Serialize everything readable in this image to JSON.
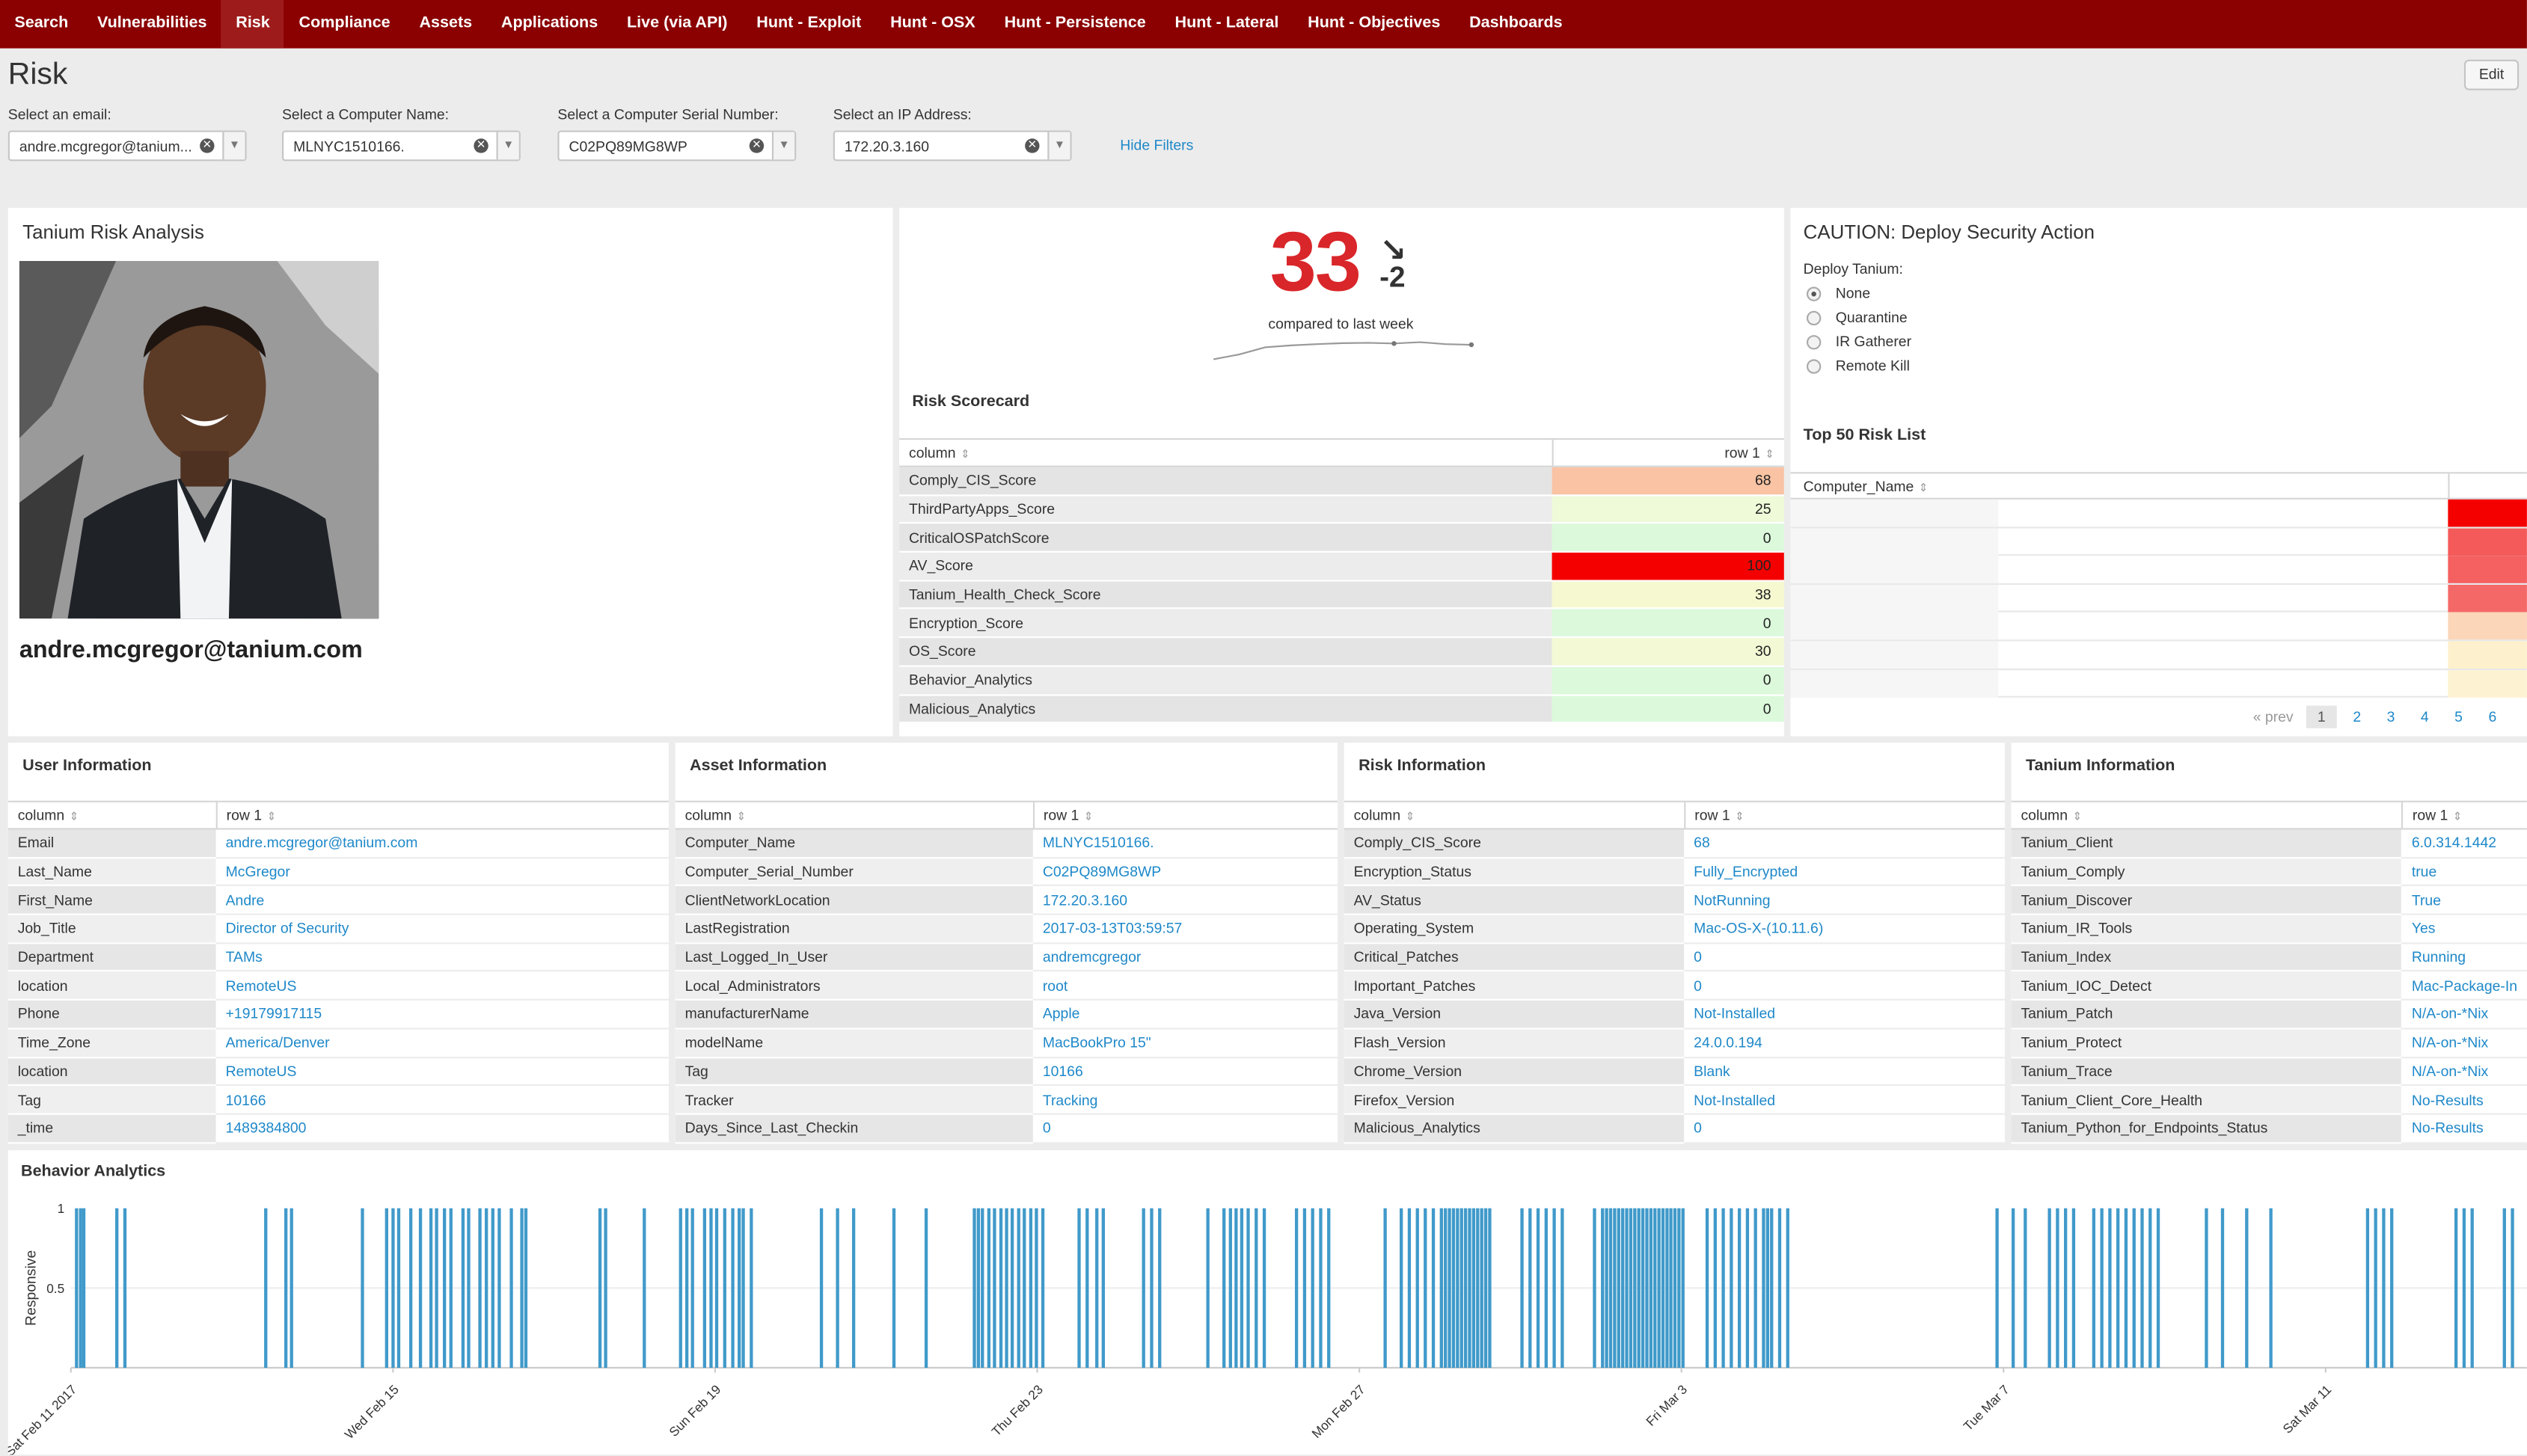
{
  "nav": [
    "Search",
    "Vulnerabilities",
    "Risk",
    "Compliance",
    "Assets",
    "Applications",
    "Live (via API)",
    "Hunt - Exploit",
    "Hunt - OSX",
    "Hunt - Persistence",
    "Hunt - Lateral",
    "Hunt - Objectives",
    "Dashboards"
  ],
  "page": {
    "title": "Risk",
    "edit_label": "Edit",
    "hide_filters": "Hide Filters"
  },
  "filters": [
    {
      "label": "Select an email:",
      "value": "andre.mcgregor@tanium..."
    },
    {
      "label": "Select a Computer Name:",
      "value": "MLNYC1510166."
    },
    {
      "label": "Select a Computer Serial Number:",
      "value": "C02PQ89MG8WP"
    },
    {
      "label": "Select an IP Address:",
      "value": "172.20.3.160"
    }
  ],
  "risk_analysis": {
    "title": "Tanium Risk Analysis",
    "email": "andre.mcgregor@tanium.com"
  },
  "score": {
    "value": "33",
    "delta": "-2",
    "caption": "compared to last week",
    "trend": [
      0.15,
      0.3,
      0.52,
      0.58,
      0.62,
      0.65,
      0.66,
      0.64,
      0.68,
      0.62,
      0.6
    ],
    "accent": "#d9262a"
  },
  "scorecard": {
    "title": "Risk Scorecard",
    "col1": "column",
    "col2": "row 1",
    "rows": [
      {
        "k": "Comply_CIS_Score",
        "v": "68",
        "color": "#f9c3a4"
      },
      {
        "k": "ThirdPartyApps_Score",
        "v": "25",
        "color": "#eefad8"
      },
      {
        "k": "CriticalOSPatchScore",
        "v": "0",
        "color": "#dcf9dc"
      },
      {
        "k": "AV_Score",
        "v": "100",
        "color": "#f50000"
      },
      {
        "k": "Tanium_Health_Check_Score",
        "v": "38",
        "color": "#f6f8d0"
      },
      {
        "k": "Encryption_Score",
        "v": "0",
        "color": "#dcf9dc"
      },
      {
        "k": "OS_Score",
        "v": "30",
        "color": "#f2f9d4"
      },
      {
        "k": "Behavior_Analytics",
        "v": "0",
        "color": "#dcf9dc"
      },
      {
        "k": "Malicious_Analytics",
        "v": "0",
        "color": "#dcf9dc"
      }
    ]
  },
  "caution": {
    "title": "CAUTION: Deploy Security Action",
    "deploy_label": "Deploy Tanium:",
    "options": [
      "None",
      "Quarantine",
      "IR Gatherer",
      "Remote Kill"
    ],
    "selected": 0
  },
  "top50": {
    "title": "Top 50 Risk List",
    "col": "Computer_Name",
    "bars": [
      "#f50000",
      "#f55a5a",
      "#f56060",
      "#f56868",
      "#fbd6b8",
      "#fdf0cc",
      "#fdf3d2"
    ],
    "pager": {
      "prev": "« prev",
      "pages": [
        "1",
        "2",
        "3",
        "4",
        "5",
        "6"
      ]
    }
  },
  "info_panels": [
    {
      "title": "User Information",
      "col1": "column",
      "col2": "row 1",
      "rows": [
        [
          "Email",
          "andre.mcgregor@tanium.com"
        ],
        [
          "Last_Name",
          "McGregor"
        ],
        [
          "First_Name",
          "Andre"
        ],
        [
          "Job_Title",
          "Director of Security"
        ],
        [
          "Department",
          "TAMs"
        ],
        [
          "location",
          "RemoteUS"
        ],
        [
          "Phone",
          "+19179917115"
        ],
        [
          "Time_Zone",
          "America/Denver"
        ],
        [
          "location",
          "RemoteUS"
        ],
        [
          "Tag",
          "10166"
        ],
        [
          "_time",
          "1489384800"
        ]
      ]
    },
    {
      "title": "Asset Information",
      "col1": "column",
      "col2": "row 1",
      "rows": [
        [
          "Computer_Name",
          "MLNYC1510166."
        ],
        [
          "Computer_Serial_Number",
          "C02PQ89MG8WP"
        ],
        [
          "ClientNetworkLocation",
          "172.20.3.160"
        ],
        [
          "LastRegistration",
          "2017-03-13T03:59:57"
        ],
        [
          "Last_Logged_In_User",
          "andremcgregor"
        ],
        [
          "Local_Administrators",
          "root"
        ],
        [
          "manufacturerName",
          "Apple"
        ],
        [
          "modelName",
          "MacBookPro 15\""
        ],
        [
          "Tag",
          "10166"
        ],
        [
          "Tracker",
          "Tracking"
        ],
        [
          "Days_Since_Last_Checkin",
          "0"
        ]
      ]
    },
    {
      "title": "Risk Information",
      "col1": "column",
      "col2": "row 1",
      "rows": [
        [
          "Comply_CIS_Score",
          "68"
        ],
        [
          "Encryption_Status",
          "Fully_Encrypted"
        ],
        [
          "AV_Status",
          "NotRunning"
        ],
        [
          "Operating_System",
          "Mac-OS-X-(10.11.6)"
        ],
        [
          "Critical_Patches",
          "0"
        ],
        [
          "Important_Patches",
          "0"
        ],
        [
          "Java_Version",
          "Not-Installed"
        ],
        [
          "Flash_Version",
          "24.0.0.194"
        ],
        [
          "Chrome_Version",
          "Blank"
        ],
        [
          "Firefox_Version",
          "Not-Installed"
        ],
        [
          "Malicious_Analytics",
          "0"
        ]
      ]
    },
    {
      "title": "Tanium Information",
      "col1": "column",
      "col2": "row 1",
      "rows": [
        [
          "Tanium_Client",
          "6.0.314.1442"
        ],
        [
          "Tanium_Comply",
          "true"
        ],
        [
          "Tanium_Discover",
          "True"
        ],
        [
          "Tanium_IR_Tools",
          "Yes"
        ],
        [
          "Tanium_Index",
          "Running"
        ],
        [
          "Tanium_IOC_Detect",
          "Mac-Package-In"
        ],
        [
          "Tanium_Patch",
          "N/A-on-*Nix"
        ],
        [
          "Tanium_Protect",
          "N/A-on-*Nix"
        ],
        [
          "Tanium_Trace",
          "N/A-on-*Nix"
        ],
        [
          "Tanium_Client_Core_Health",
          "No-Results"
        ],
        [
          "Tanium_Python_for_Endpoints_Status",
          "No-Results"
        ]
      ]
    }
  ],
  "chart_data": {
    "type": "bar",
    "title": "Behavior Analytics",
    "ylabel": "Responsive",
    "ylim": [
      0,
      1
    ],
    "yticks": [
      "1",
      "0.5"
    ],
    "xticks": [
      "Sat Feb 11 2017",
      "Wed Feb 15",
      "Sun Feb 19",
      "Thu Feb 23",
      "Mon Feb 27",
      "Fri Mar 3",
      "Tue Mar 7",
      "Sat Mar 11"
    ],
    "x_range_days": [
      0,
      30.5
    ],
    "series_color": "#2b8fc4",
    "event_days": [
      0.05,
      0.1,
      0.14,
      0.55,
      0.65,
      2.4,
      2.65,
      2.72,
      3.6,
      3.9,
      3.98,
      4.05,
      4.2,
      4.32,
      4.45,
      4.52,
      4.62,
      4.7,
      4.85,
      4.92,
      5.06,
      5.14,
      5.22,
      5.3,
      5.45,
      5.58,
      5.63,
      6.55,
      6.62,
      7.1,
      7.55,
      7.63,
      7.7,
      7.85,
      7.93,
      8.0,
      8.1,
      8.2,
      8.28,
      8.33,
      8.43,
      9.3,
      9.5,
      9.7,
      10.2,
      10.6,
      11.2,
      11.25,
      11.3,
      11.38,
      11.45,
      11.53,
      11.6,
      11.67,
      11.75,
      11.82,
      11.9,
      11.97,
      12.05,
      12.5,
      12.6,
      12.72,
      12.8,
      13.3,
      13.4,
      13.5,
      14.1,
      14.3,
      14.38,
      14.45,
      14.52,
      14.6,
      14.7,
      14.8,
      15.2,
      15.3,
      15.4,
      15.5,
      15.6,
      16.3,
      16.5,
      16.6,
      16.7,
      16.8,
      16.9,
      17.0,
      17.05,
      17.1,
      17.15,
      17.2,
      17.25,
      17.3,
      17.35,
      17.4,
      17.45,
      17.5,
      17.55,
      17.6,
      18.0,
      18.1,
      18.2,
      18.3,
      18.4,
      18.5,
      18.9,
      19.0,
      19.05,
      19.1,
      19.15,
      19.2,
      19.25,
      19.3,
      19.35,
      19.4,
      19.45,
      19.5,
      19.55,
      19.6,
      19.65,
      19.7,
      19.75,
      19.8,
      19.85,
      19.9,
      19.95,
      20.0,
      20.3,
      20.4,
      20.5,
      20.6,
      20.7,
      20.8,
      20.9,
      21.0,
      21.05,
      21.1,
      21.2,
      21.3,
      23.9,
      24.1,
      24.25,
      24.55,
      24.65,
      24.75,
      24.85,
      25.1,
      25.2,
      25.3,
      25.4,
      25.5,
      25.6,
      25.7,
      25.8,
      25.9,
      26.5,
      26.7,
      27.0,
      27.3,
      28.5,
      28.6,
      28.7,
      28.8,
      29.6,
      29.7,
      29.8,
      30.2,
      30.3
    ]
  }
}
